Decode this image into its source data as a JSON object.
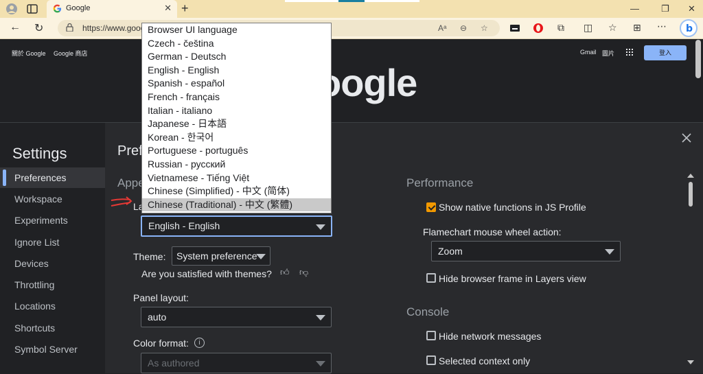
{
  "browser": {
    "tab_title": "Google",
    "url": "https://www.goog",
    "close_tab": "✕",
    "new_tab": "+"
  },
  "google_page": {
    "left_links": [
      "關於 Google",
      "Google 商店"
    ],
    "gmail": "Gmail",
    "images": "圖片",
    "signin": "登入",
    "logo_text": "oogle"
  },
  "settings": {
    "heading": "Settings",
    "sidebar": [
      {
        "label": "Preferences",
        "active": true
      },
      {
        "label": "Workspace"
      },
      {
        "label": "Experiments"
      },
      {
        "label": "Ignore List"
      },
      {
        "label": "Devices"
      },
      {
        "label": "Throttling"
      },
      {
        "label": "Locations"
      },
      {
        "label": "Shortcuts"
      },
      {
        "label": "Symbol Server"
      }
    ],
    "content_title": "Pref",
    "appearance_section": "Appe",
    "language_label": "La",
    "language_value": "English - English",
    "theme_label": "Theme:",
    "theme_value": "System preference",
    "satisfied_text": "Are you satisfied with themes?",
    "panel_layout_label": "Panel layout:",
    "panel_layout_value": "auto",
    "color_format_label": "Color format:",
    "color_format_value": "As authored",
    "performance_section": "Performance",
    "show_native_label": "Show native functions in JS Profile",
    "show_native_checked": true,
    "flamechart_label": "Flamechart mouse wheel action:",
    "flamechart_value": "Zoom",
    "hide_browser_frame_label": "Hide browser frame in Layers view",
    "console_section": "Console",
    "hide_network_label": "Hide network messages",
    "selected_context_label": "Selected context only"
  },
  "language_options": [
    "Browser UI language",
    "Czech - čeština",
    "German - Deutsch",
    "English - English",
    "Spanish - español",
    "French - français",
    "Italian - italiano",
    "Japanese - 日本語",
    "Korean - 한국어",
    "Portuguese - português",
    "Russian - русский",
    "Vietnamese - Tiếng Việt",
    "Chinese (Simplified) - 中文 (简体)",
    "Chinese (Traditional) - 中文 (繁體)"
  ],
  "highlighted_option_index": 13,
  "colors": {
    "accent": "#8ab4f8",
    "checkbox_on": "#f29900",
    "browser_frame": "#f3e1b0"
  }
}
